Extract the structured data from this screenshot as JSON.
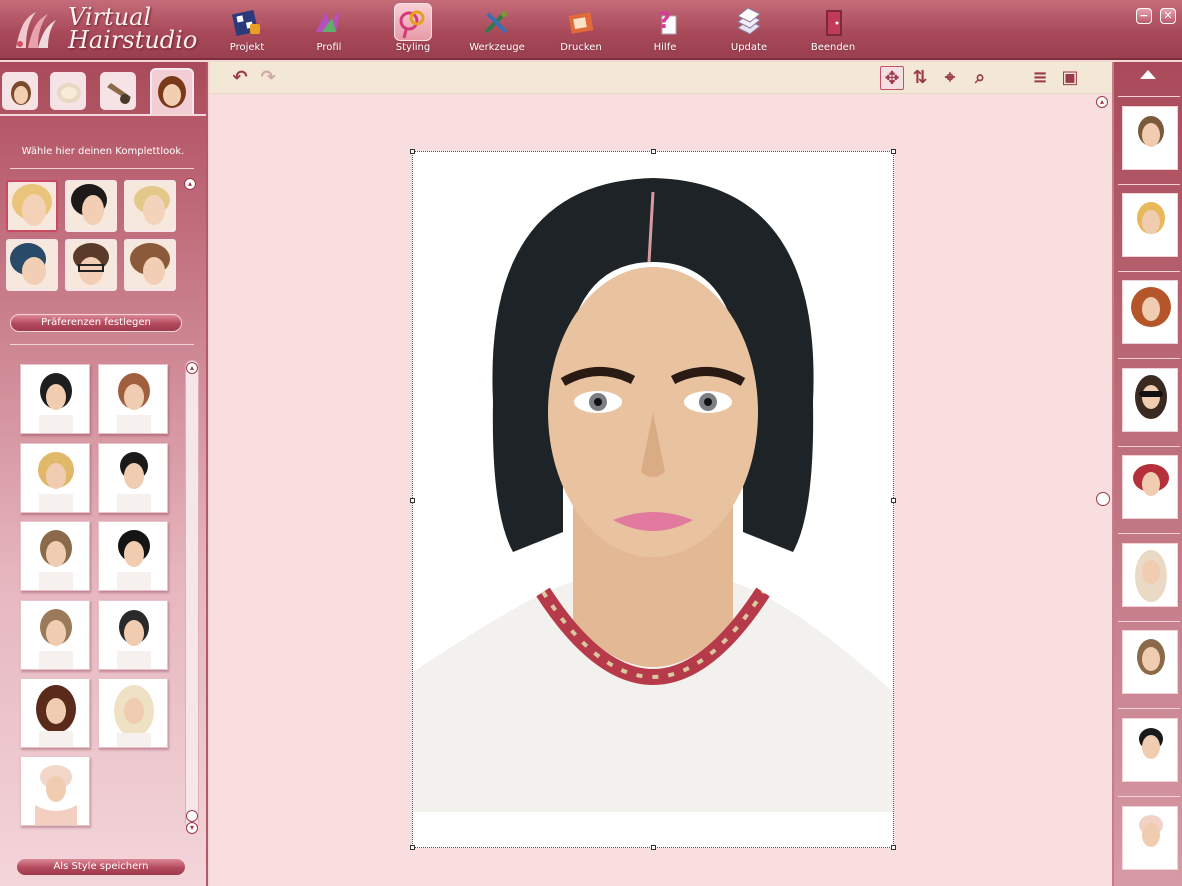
{
  "app": {
    "logo_line1": "Virtual",
    "logo_line2": "Hairstudio"
  },
  "toolbar": {
    "items": [
      {
        "label": "Projekt",
        "icon": "project-icon"
      },
      {
        "label": "Profil",
        "icon": "profile-icon"
      },
      {
        "label": "Styling",
        "icon": "styling-icon",
        "active": true
      },
      {
        "label": "Werkzeuge",
        "icon": "tools-icon"
      },
      {
        "label": "Drucken",
        "icon": "print-icon"
      },
      {
        "label": "Hilfe",
        "icon": "help-icon"
      },
      {
        "label": "Update",
        "icon": "update-icon"
      },
      {
        "label": "Beenden",
        "icon": "exit-icon"
      }
    ]
  },
  "window": {
    "minimize": "−",
    "close": "✕"
  },
  "left_panel": {
    "hint": "Wähle hier deinen Komplettlook.",
    "preferences_button": "Präferenzen festlegen",
    "save_style_button": "Als Style speichern"
  },
  "canvas_toolbar": {
    "undo": "↶",
    "redo": "↷",
    "move": "✥",
    "rotate": "⇅",
    "center": "⌖",
    "zoom": "⌕",
    "menu": "≡",
    "view": "▣"
  },
  "colors": {
    "accent": "#a94a5a",
    "canvas_bg": "#f8dede",
    "toolbar_bg": "#f3e7d6"
  }
}
